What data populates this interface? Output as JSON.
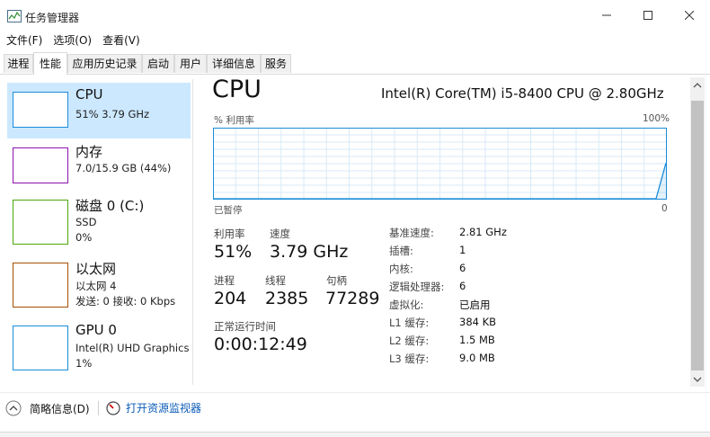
{
  "window": {
    "title": "任务管理器"
  },
  "menu": [
    "文件(F)",
    "选项(O)",
    "查看(V)"
  ],
  "tabs": [
    "进程",
    "性能",
    "应用历史记录",
    "启动",
    "用户",
    "详细信息",
    "服务"
  ],
  "active_tab": "性能",
  "sidebar": {
    "items": [
      {
        "title": "CPU",
        "sub1": "51%  3.79 GHz",
        "sub2": "",
        "sub3": "",
        "border_color": "#1a8cd8",
        "selected": true
      },
      {
        "title": "内存",
        "sub1": "7.0/15.9 GB (44%)",
        "sub2": "",
        "sub3": "",
        "border_color": "#8b12ae"
      },
      {
        "title": "磁盘 0 (C:)",
        "sub1": "SSD",
        "sub2": "0%",
        "sub3": "",
        "border_color": "#4da60c"
      },
      {
        "title": "以太网",
        "sub1": "以太网 4",
        "sub2": "发送: 0 接收: 0 Kbps",
        "sub3": "",
        "border_color": "#a74f01"
      },
      {
        "title": "GPU 0",
        "sub1": "Intel(R) UHD Graphics",
        "sub2": "1%",
        "sub3": "",
        "border_color": "#1a8cd8"
      }
    ]
  },
  "main": {
    "title": "CPU",
    "model": "Intel(R) Core(TM) i5-8400 CPU @ 2.80GHz",
    "graph_left_label": "% 利用率",
    "graph_right_label": "100%",
    "graph_bottom_left": "已暂停",
    "graph_bottom_right": "0",
    "graph_color": "#1a8cd8",
    "utilization_points": [
      0,
      0,
      0,
      0,
      0,
      0,
      0,
      0,
      0,
      0,
      0,
      0,
      0,
      0,
      0,
      0,
      0,
      0,
      0,
      0,
      0,
      0,
      0,
      0,
      0,
      0,
      0,
      0,
      0,
      51
    ]
  },
  "stats": {
    "util_label": "利用率",
    "util_value": "51%",
    "speed_label": "速度",
    "speed_value": "3.79 GHz",
    "proc_label": "进程",
    "proc_value": "204",
    "thread_label": "线程",
    "thread_value": "2385",
    "handle_label": "句柄",
    "handle_value": "77289",
    "uptime_label": "正常运行时间",
    "uptime_value": "0:00:12:49"
  },
  "specs": [
    {
      "label": "基准速度:",
      "value": "2.81 GHz"
    },
    {
      "label": "插槽:",
      "value": "1"
    },
    {
      "label": "内核:",
      "value": "6"
    },
    {
      "label": "逻辑处理器:",
      "value": "6"
    },
    {
      "label": "虚拟化:",
      "value": "已启用"
    },
    {
      "label": "L1 缓存:",
      "value": "384 KB"
    },
    {
      "label": "L2 缓存:",
      "value": "1.5 MB"
    },
    {
      "label": "L3 缓存:",
      "value": "9.0 MB"
    }
  ],
  "footer": {
    "brief_label": "简略信息(D)",
    "monitor_label": "打开资源监视器"
  }
}
